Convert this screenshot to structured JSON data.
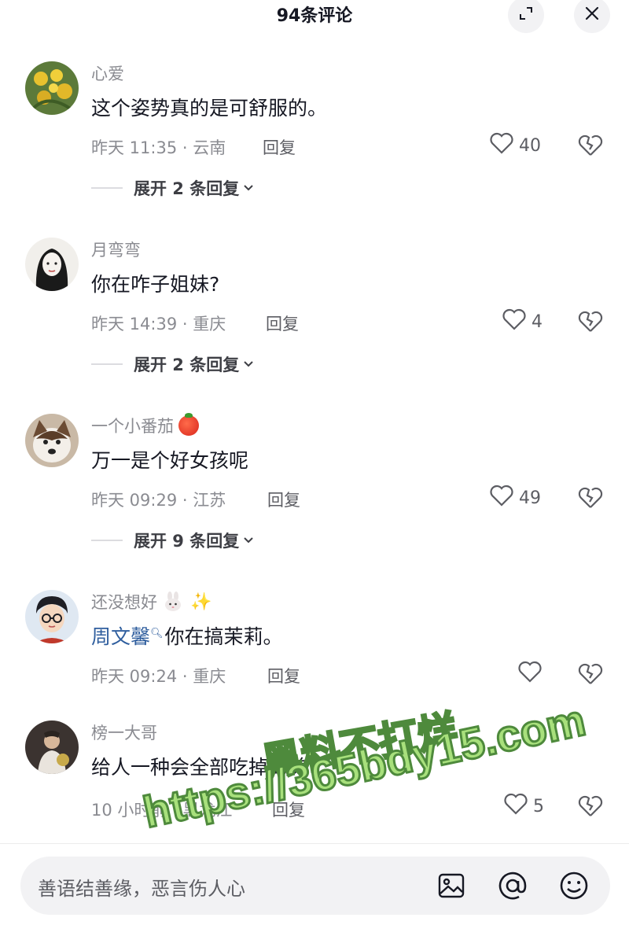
{
  "header": {
    "title": "94条评论",
    "expand_icon": "fullscreen-icon",
    "close_icon": "close-icon"
  },
  "comments": [
    {
      "username": "心爱",
      "content": "这个姿势真的是可舒服的。",
      "meta": "昨天 11:35 · 云南",
      "reply_label": "回复",
      "likes": "40",
      "expand_label": "展开 2 条回复"
    },
    {
      "username": "月弯弯",
      "content": "你在咋子姐妹?",
      "meta": "昨天 14:39 · 重庆",
      "reply_label": "回复",
      "likes": "4",
      "expand_label": "展开 2 条回复"
    },
    {
      "username": "一个小番茄",
      "content": "万一是个好女孩呢",
      "meta": "昨天 09:29 · 江苏",
      "reply_label": "回复",
      "likes": "49",
      "expand_label": "展开 9 条回复"
    },
    {
      "username": "还没想好",
      "mention": "周文馨",
      "content": "你在搞茉莉。",
      "meta": "昨天 09:24 · 重庆",
      "reply_label": "回复",
      "likes": ""
    },
    {
      "username": "榜一大哥",
      "content": "给人一种会全部吃掉的美",
      "meta": "10 小时前 · 黑龙江",
      "reply_label": "回复",
      "likes": "5"
    }
  ],
  "input": {
    "placeholder": "善语结善缘，恶言伤人心"
  },
  "watermark": {
    "line1": "黑料不打烊",
    "line2": "https://365bdy15.com"
  },
  "colors": {
    "text_primary": "#161823",
    "text_secondary": "#8a8b91",
    "mention": "#2f5e9e",
    "watermark": "#a8e07c"
  }
}
